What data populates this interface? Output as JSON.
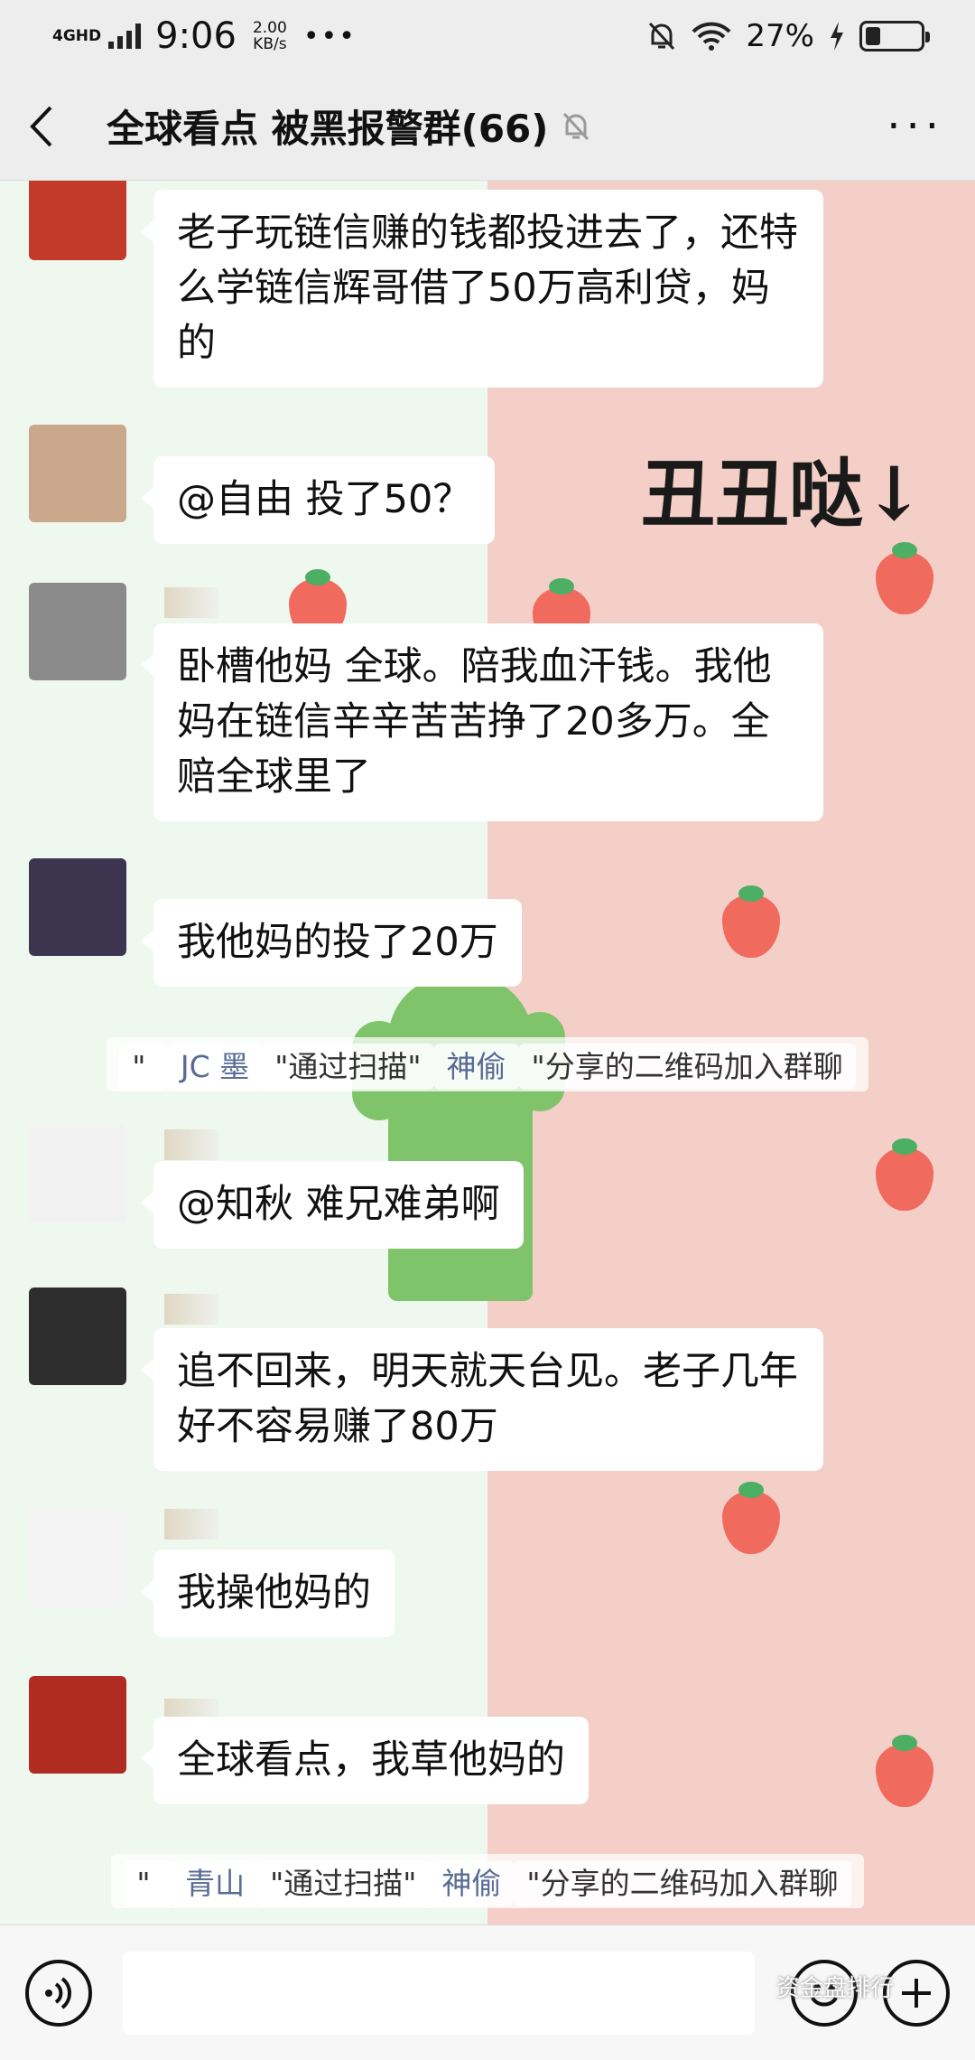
{
  "status_bar": {
    "network": "4GHD",
    "time": "9:06",
    "speed_value": "2.00",
    "speed_unit": "KB/s",
    "more": "•••",
    "battery": "27%",
    "battery_level": 0.27
  },
  "header": {
    "title": "全球看点 被黑报警群(66)",
    "more": "···",
    "icons": {
      "back": "chevron-left-icon",
      "mute": "bell-off-icon",
      "more": "more-icon"
    }
  },
  "wallpaper": {
    "text": "丑丑哒↓"
  },
  "messages": [
    {
      "text": "老子玩链信赚的钱都投进去了，还特么学链信辉哥借了50万高利贷，妈的"
    },
    {
      "text": "@自由  投了50？"
    },
    {
      "text": "卧槽他妈  全球。陪我血汗钱。我他妈在链信辛辛苦苦挣了20多万。全赔全球里了"
    },
    {
      "text": "我他妈的投了20万"
    },
    {
      "text": "@知秋  难兄难弟啊"
    },
    {
      "text": "追不回来，明天就天台见。老子几年好不容易赚了80万"
    },
    {
      "text": "我操他妈的"
    },
    {
      "text": "全球看点，我草他妈的"
    }
  ],
  "system_notices": [
    {
      "q1": "\" ",
      "name": "JC 墨",
      "mid": "\"通过扫描\"",
      "sharer": "神偷",
      "end": "\"分享的二维码加入群聊"
    },
    {
      "q1": "\" ",
      "name": "青山",
      "mid": "\"通过扫描\"",
      "sharer": "神偷",
      "end": "\"分享的二维码加入群聊"
    }
  ],
  "input_bar": {
    "watermark": "资金盘排行"
  },
  "colors": {
    "link": "#576b95",
    "bg": "#ededed",
    "bubble": "#ffffff"
  }
}
